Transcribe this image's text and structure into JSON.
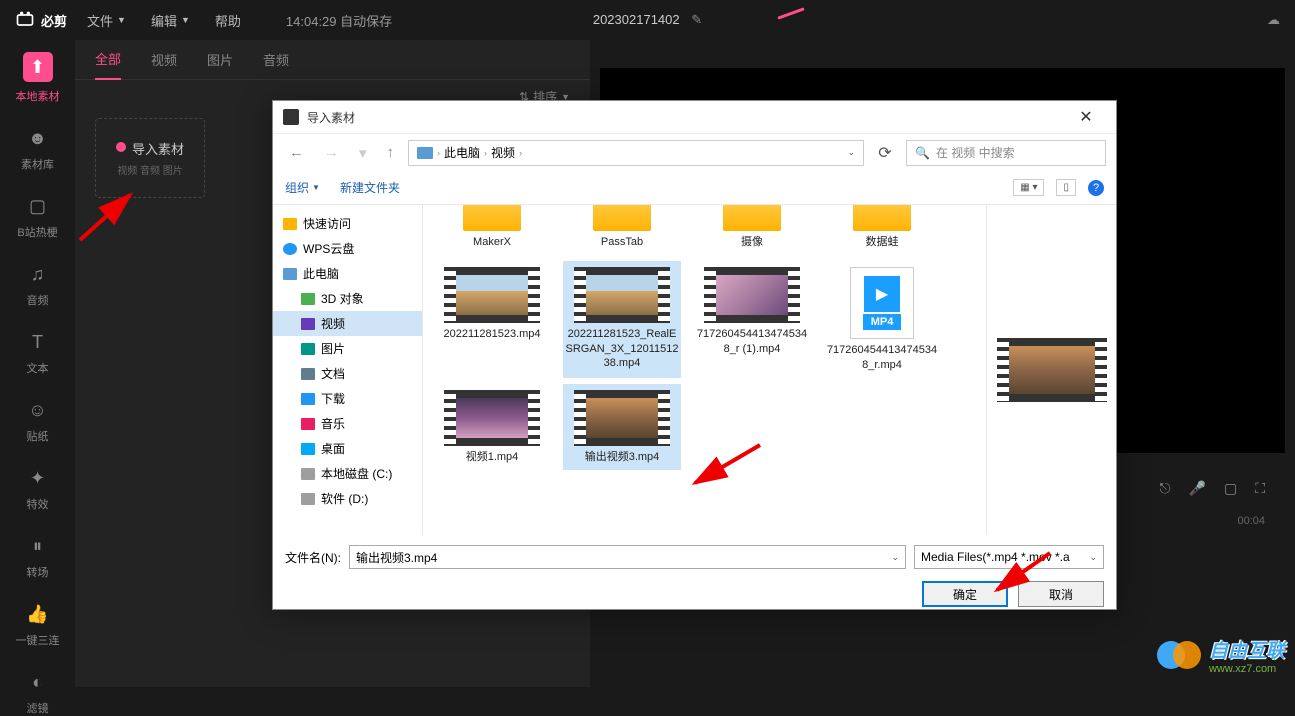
{
  "app": {
    "name": "必剪"
  },
  "top_menu": {
    "file": "文件",
    "edit": "编辑",
    "help": "帮助",
    "autosave": "14:04:29 自动保存",
    "project": "202302171402"
  },
  "sidebar": {
    "items": [
      {
        "label": "本地素材"
      },
      {
        "label": "素材库"
      },
      {
        "label": "B站热梗"
      },
      {
        "label": "音频"
      },
      {
        "label": "文本"
      },
      {
        "label": "贴纸"
      },
      {
        "label": "特效"
      },
      {
        "label": "转场"
      },
      {
        "label": "一键三连"
      },
      {
        "label": "滤镜"
      }
    ]
  },
  "content": {
    "tabs": [
      {
        "label": "全部"
      },
      {
        "label": "视频"
      },
      {
        "label": "图片"
      },
      {
        "label": "音频"
      }
    ],
    "sort": "排序",
    "import": {
      "label": "导入素材",
      "sub": "视频 音频 图片"
    }
  },
  "timeline": {
    "time": "00:04"
  },
  "dialog": {
    "title": "导入素材",
    "breadcrumb": {
      "pc": "此电脑",
      "folder": "视频"
    },
    "search_placeholder": "在 视频 中搜索",
    "toolbar": {
      "organize": "组织",
      "newfolder": "新建文件夹"
    },
    "tree": [
      {
        "label": "快速访问",
        "ic": "ic-star"
      },
      {
        "label": "WPS云盘",
        "ic": "ic-cloud"
      },
      {
        "label": "此电脑",
        "ic": "ic-pc"
      },
      {
        "label": "3D 对象",
        "ic": "ic-3d",
        "indent": true
      },
      {
        "label": "视频",
        "ic": "ic-vid",
        "indent": true,
        "selected": true
      },
      {
        "label": "图片",
        "ic": "ic-img",
        "indent": true
      },
      {
        "label": "文档",
        "ic": "ic-doc",
        "indent": true
      },
      {
        "label": "下载",
        "ic": "ic-dl",
        "indent": true
      },
      {
        "label": "音乐",
        "ic": "ic-mus",
        "indent": true
      },
      {
        "label": "桌面",
        "ic": "ic-desk",
        "indent": true
      },
      {
        "label": "本地磁盘 (C:)",
        "ic": "ic-disk",
        "indent": true
      },
      {
        "label": "软件 (D:)",
        "ic": "ic-disk",
        "indent": true
      }
    ],
    "folders": [
      {
        "name": "MakerX"
      },
      {
        "name": "PassTab"
      },
      {
        "name": "摄像"
      },
      {
        "name": "数据蛙"
      }
    ],
    "files": [
      {
        "name": "202211281523.mp4",
        "thumb": "vt-1"
      },
      {
        "name": "202211281523_RealESRGAN_3X_1201151238.mp4",
        "thumb": "vt-1",
        "selected": true
      },
      {
        "name": "7172604544134745348_r (1).mp4",
        "thumb": "vt-2"
      },
      {
        "name": "7172604544134745348_r.mp4",
        "thumb": "mp4"
      },
      {
        "name": "视频1.mp4",
        "thumb": "vt-3"
      },
      {
        "name": "输出视频3.mp4",
        "thumb": "vt-4",
        "selected": true
      }
    ],
    "filename_label": "文件名(N):",
    "filename_value": "输出视频3.mp4",
    "filetype": "Media Files(*.mp4 *.mov *.a",
    "ok": "确定",
    "cancel": "取消"
  },
  "watermark": {
    "text": "自由互联",
    "url": "www.xz7.com"
  }
}
